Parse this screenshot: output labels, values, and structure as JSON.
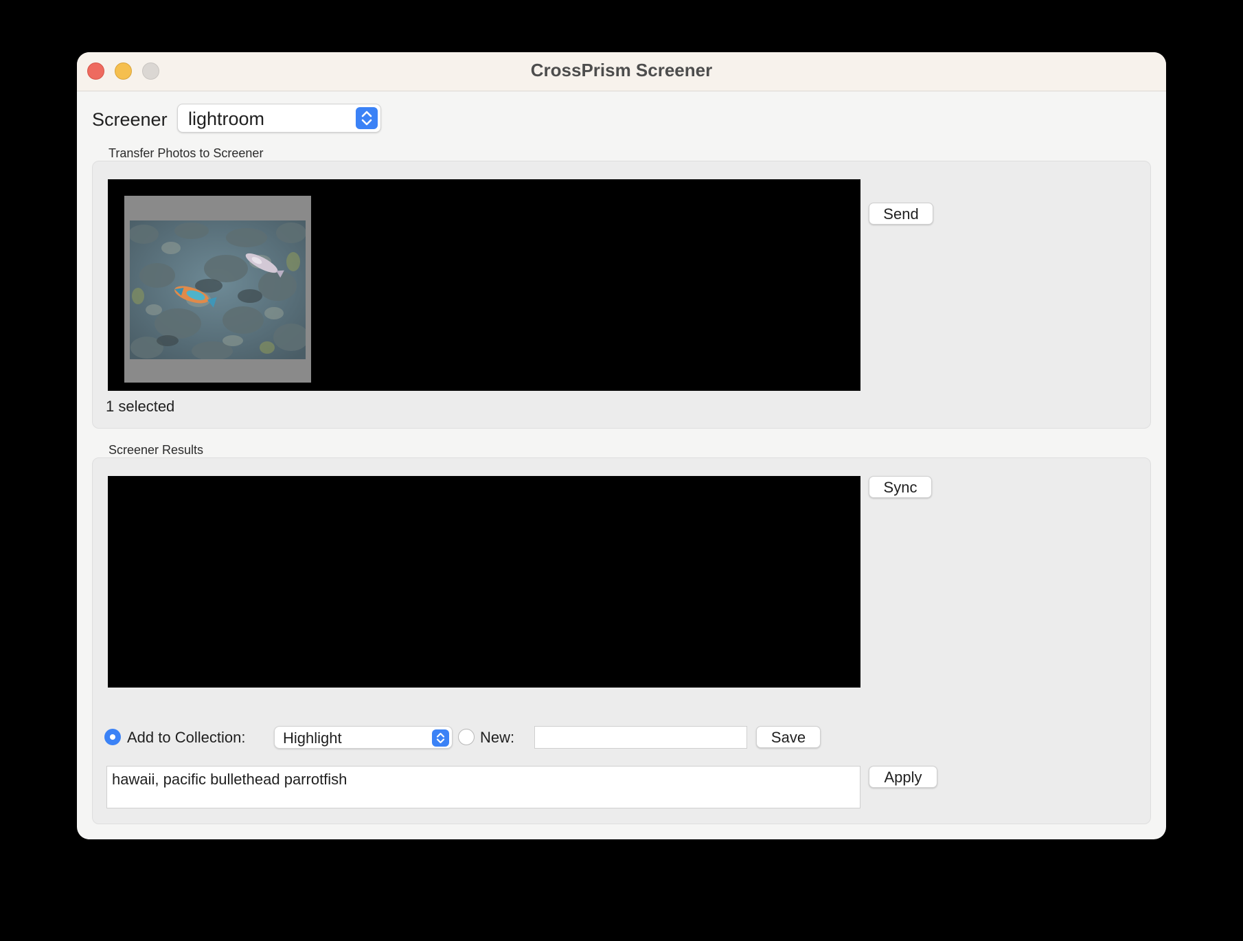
{
  "window": {
    "title": "CrossPrism Screener"
  },
  "screener": {
    "label": "Screener",
    "selected": "lightroom"
  },
  "transfer": {
    "group_label": "Transfer Photos to Screener",
    "send_label": "Send",
    "selection_status": "1 selected"
  },
  "results": {
    "group_label": "Screener Results",
    "sync_label": "Sync"
  },
  "collection": {
    "add_label": "Add to Collection:",
    "selected_collection": "Highlight",
    "new_label": "New:",
    "new_value": "",
    "save_label": "Save",
    "add_selected": true
  },
  "keywords": {
    "value": "hawaii, pacific bullethead parrotfish",
    "apply_label": "Apply"
  },
  "colors": {
    "accent": "#3b82f6",
    "close": "#ee6a5f",
    "minimize": "#f5bf4f",
    "zoom": "#dbd7d3"
  },
  "icons": {
    "popup_stepper": "up-down-chevron-icon",
    "photo": "underwater-fish-photo"
  }
}
